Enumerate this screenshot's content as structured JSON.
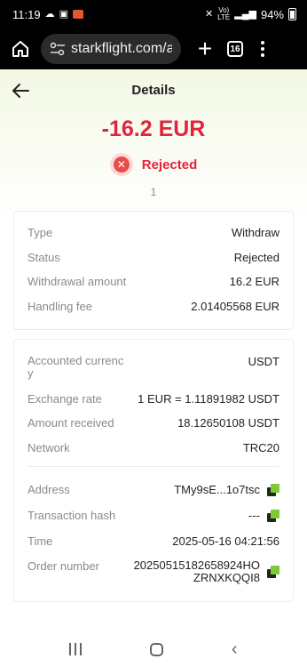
{
  "status_bar": {
    "time": "11:19",
    "signal_top": "VoLTE",
    "signal_label_1": "Vo)",
    "signal_label_2": "LTE",
    "battery": "94%"
  },
  "browser": {
    "url": "starkflight.com/a",
    "tab_count": "16"
  },
  "header": {
    "title": "Details"
  },
  "summary": {
    "amount": "-16.2 EUR",
    "status": "Rejected",
    "count": "1"
  },
  "card1": [
    {
      "label": "Type",
      "value": "Withdraw"
    },
    {
      "label": "Status",
      "value": "Rejected"
    },
    {
      "label": "Withdrawal amount",
      "value": "16.2 EUR"
    },
    {
      "label": "Handling fee",
      "value": "2.01405568 EUR"
    }
  ],
  "card2_top": [
    {
      "label": "Accounted currenc y",
      "value": "USDT"
    },
    {
      "label": "Exchange rate",
      "value": "1 EUR = 1.11891982 USDT"
    },
    {
      "label": "Amount received",
      "value": "18.12650108 USDT"
    },
    {
      "label": "Network",
      "value": "TRC20"
    }
  ],
  "card2_bottom": {
    "address": {
      "label": "Address",
      "value": "TMy9sE...1o7tsc"
    },
    "tx_hash": {
      "label": "Transaction hash",
      "value": "---"
    },
    "time": {
      "label": "Time",
      "value": "2025-05-16 04:21:56"
    },
    "order": {
      "label": "Order number",
      "value": "20250515182658924HOZRNXKQQI8"
    }
  },
  "colors": {
    "accent_red": "#e0243c",
    "copy_green": "#7ec83a",
    "page_tint": "#f3f8e4"
  }
}
